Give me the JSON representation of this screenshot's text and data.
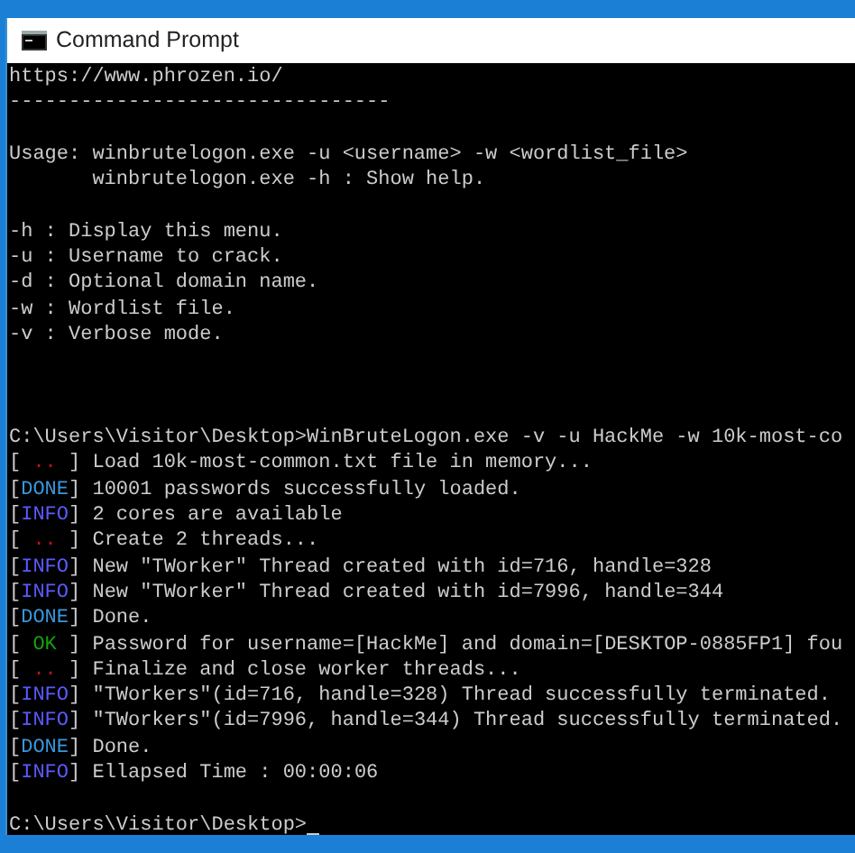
{
  "window": {
    "title": "Command Prompt"
  },
  "terminal": {
    "cursor_visible": true,
    "lines": [
      {
        "kind": "text",
        "segments": [
          {
            "text": "https://www.phrozen.io/"
          }
        ]
      },
      {
        "kind": "text",
        "segments": [
          {
            "text": "--------------------------------"
          }
        ]
      },
      {
        "kind": "blank"
      },
      {
        "kind": "text",
        "segments": [
          {
            "text": "Usage: winbrutelogon.exe -u <username> -w <wordlist_file>"
          }
        ]
      },
      {
        "kind": "text",
        "segments": [
          {
            "text": "       winbrutelogon.exe -h : Show help."
          }
        ]
      },
      {
        "kind": "blank"
      },
      {
        "kind": "text",
        "segments": [
          {
            "text": "-h : Display this menu."
          }
        ]
      },
      {
        "kind": "text",
        "segments": [
          {
            "text": "-u : Username to crack."
          }
        ]
      },
      {
        "kind": "text",
        "segments": [
          {
            "text": "-d : Optional domain name."
          }
        ]
      },
      {
        "kind": "text",
        "segments": [
          {
            "text": "-w : Wordlist file."
          }
        ]
      },
      {
        "kind": "text",
        "segments": [
          {
            "text": "-v : Verbose mode."
          }
        ]
      },
      {
        "kind": "blank"
      },
      {
        "kind": "blank"
      },
      {
        "kind": "blank"
      },
      {
        "kind": "text",
        "segments": [
          {
            "text": "C:\\Users\\Visitor\\Desktop>WinBruteLogon.exe -v -u HackMe -w 10k-most-co"
          }
        ]
      },
      {
        "kind": "text",
        "segments": [
          {
            "text": "["
          },
          {
            "text": " .. ",
            "kind": "progress"
          },
          {
            "text": "] Load 10k-most-common.txt file in memory..."
          }
        ]
      },
      {
        "kind": "text",
        "segments": [
          {
            "text": "["
          },
          {
            "text": "DONE",
            "kind": "done"
          },
          {
            "text": "] 10001 passwords successfully loaded."
          }
        ]
      },
      {
        "kind": "text",
        "segments": [
          {
            "text": "["
          },
          {
            "text": "INFO",
            "kind": "info"
          },
          {
            "text": "] 2 cores are available"
          }
        ]
      },
      {
        "kind": "text",
        "segments": [
          {
            "text": "["
          },
          {
            "text": " .. ",
            "kind": "progress"
          },
          {
            "text": "] Create 2 threads..."
          }
        ]
      },
      {
        "kind": "text",
        "segments": [
          {
            "text": "["
          },
          {
            "text": "INFO",
            "kind": "info"
          },
          {
            "text": "] New \"TWorker\" Thread created with id=716, handle=328"
          }
        ]
      },
      {
        "kind": "text",
        "segments": [
          {
            "text": "["
          },
          {
            "text": "INFO",
            "kind": "info"
          },
          {
            "text": "] New \"TWorker\" Thread created with id=7996, handle=344"
          }
        ]
      },
      {
        "kind": "text",
        "segments": [
          {
            "text": "["
          },
          {
            "text": "DONE",
            "kind": "done"
          },
          {
            "text": "] Done."
          }
        ]
      },
      {
        "kind": "text",
        "segments": [
          {
            "text": "["
          },
          {
            "text": " OK ",
            "kind": "ok"
          },
          {
            "text": "] Password for username=[HackMe] and domain=[DESKTOP-0885FP1] fou"
          }
        ]
      },
      {
        "kind": "text",
        "segments": [
          {
            "text": "["
          },
          {
            "text": " .. ",
            "kind": "progress"
          },
          {
            "text": "] Finalize and close worker threads..."
          }
        ]
      },
      {
        "kind": "text",
        "segments": [
          {
            "text": "["
          },
          {
            "text": "INFO",
            "kind": "info"
          },
          {
            "text": "] \"TWorkers\"(id=716, handle=328) Thread successfully terminated."
          }
        ]
      },
      {
        "kind": "text",
        "segments": [
          {
            "text": "["
          },
          {
            "text": "INFO",
            "kind": "info"
          },
          {
            "text": "] \"TWorkers\"(id=7996, handle=344) Thread successfully terminated."
          }
        ]
      },
      {
        "kind": "text",
        "segments": [
          {
            "text": "["
          },
          {
            "text": "DONE",
            "kind": "done"
          },
          {
            "text": "] Done."
          }
        ]
      },
      {
        "kind": "text",
        "segments": [
          {
            "text": "["
          },
          {
            "text": "INFO",
            "kind": "info"
          },
          {
            "text": "] Ellapsed Time : 00:00:06"
          }
        ]
      },
      {
        "kind": "blank"
      },
      {
        "kind": "text",
        "segments": [
          {
            "text": "C:\\Users\\Visitor\\Desktop>"
          }
        ]
      }
    ]
  }
}
